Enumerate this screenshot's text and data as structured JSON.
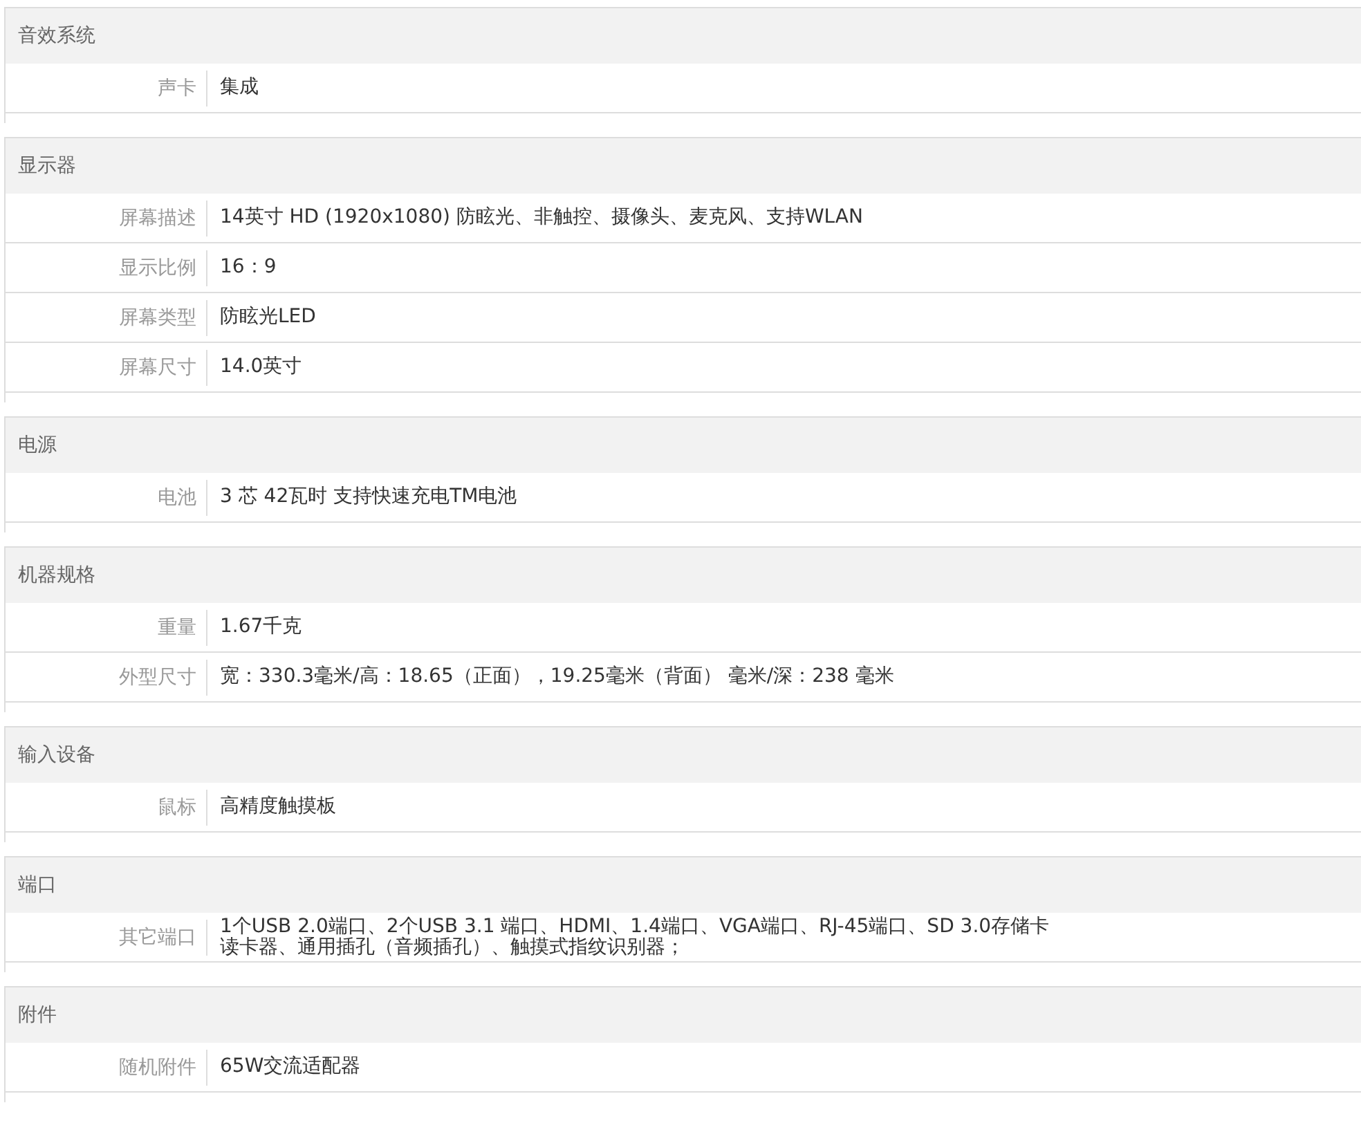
{
  "sections": [
    {
      "title": "音效系统",
      "rows": [
        {
          "label": "声卡",
          "value": "集成"
        }
      ]
    },
    {
      "title": "显示器",
      "rows": [
        {
          "label": "屏幕描述",
          "value": "14英寸 HD (1920x1080) 防眩光、非触控、摄像头、麦克风、支持WLAN"
        },
        {
          "label": "显示比例",
          "value": "16：9"
        },
        {
          "label": "屏幕类型",
          "value": "防眩光LED"
        },
        {
          "label": "屏幕尺寸",
          "value": "14.0英寸"
        }
      ]
    },
    {
      "title": "电源",
      "rows": [
        {
          "label": "电池",
          "value": "3 芯 42瓦时 支持快速充电TM电池"
        }
      ]
    },
    {
      "title": "机器规格",
      "rows": [
        {
          "label": "重量",
          "value": "1.67千克"
        },
        {
          "label": "外型尺寸",
          "value": "宽：330.3毫米/高：18.65（正面），19.25毫米（背面） 毫米/深：238 毫米"
        }
      ]
    },
    {
      "title": "输入设备",
      "rows": [
        {
          "label": "鼠标",
          "value": "高精度触摸板"
        }
      ]
    },
    {
      "title": "端口",
      "rows": [
        {
          "label": "其它端口",
          "value": "1个USB 2.0端口、2个USB 3.1 端口、HDMI、1.4端口、VGA端口、RJ-45端口、SD 3.0存储卡读卡器、通用插孔（音频插孔）、触摸式指纹识别器；"
        }
      ]
    },
    {
      "title": "附件",
      "rows": [
        {
          "label": "随机附件",
          "value": "65W交流适配器"
        }
      ]
    }
  ]
}
